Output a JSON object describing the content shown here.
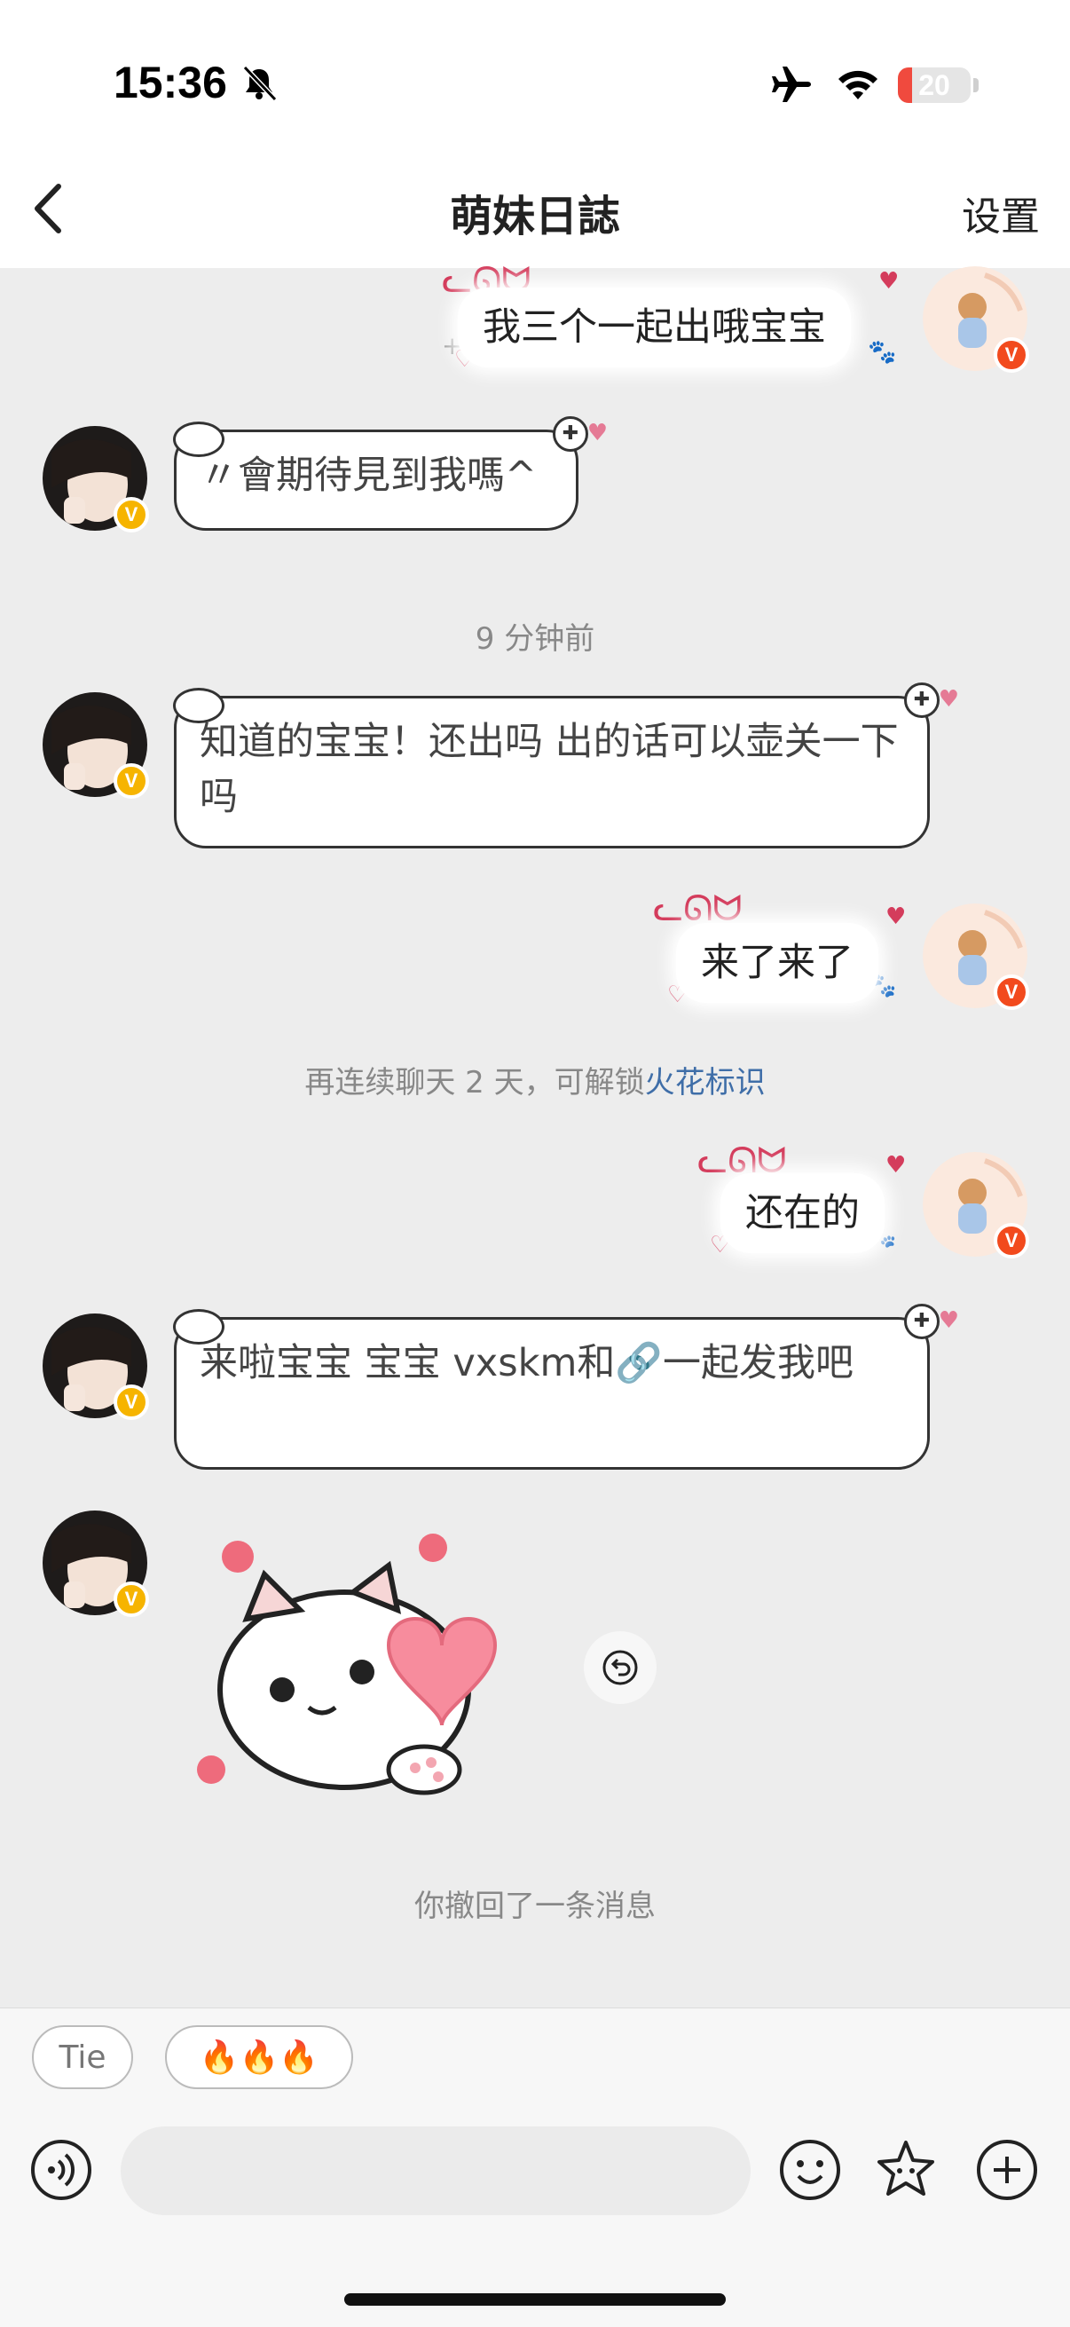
{
  "status_bar": {
    "time": "15:36",
    "battery_level": "20",
    "battery_fraction": 0.2
  },
  "header": {
    "title": "萌妹日誌",
    "settings_label": "设置"
  },
  "messages": [
    {
      "side": "right",
      "text": "我三个一起出哦宝宝"
    },
    {
      "side": "left",
      "text": "〃會期待見到我嗎^"
    },
    {
      "type": "timestamp",
      "text": "9 分钟前"
    },
    {
      "side": "left",
      "text": "知道的宝宝！还出吗 出的话可以壶关一下吗"
    },
    {
      "side": "right",
      "text": "来了来了"
    },
    {
      "type": "hint",
      "text": "再连续聊天 2 天，可解锁",
      "link": "火花标识"
    },
    {
      "side": "right",
      "text": "还在的"
    },
    {
      "side": "left",
      "text": "来啦宝宝 宝宝 vxskm和🔗一起发我吧"
    },
    {
      "side": "left",
      "type": "sticker",
      "icon": "cat-with-heart-sticker"
    },
    {
      "type": "recall",
      "text": "你撤回了一条消息"
    }
  ],
  "quick_replies": [
    {
      "label": "Tie"
    },
    {
      "label": "🔥🔥🔥"
    }
  ],
  "colors": {
    "accent_link": "#3f6ea8",
    "badge_gold": "#f6b400",
    "badge_red": "#f24a1d",
    "battery_red": "#f04a3e"
  }
}
